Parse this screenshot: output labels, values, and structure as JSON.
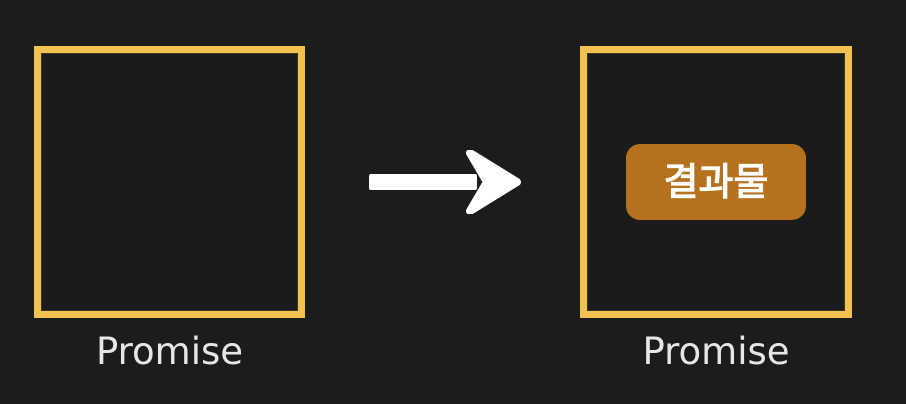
{
  "left_promise": {
    "label": "Promise"
  },
  "arrow": {
    "icon": "right-arrow-icon",
    "color": "#ffffff"
  },
  "right_promise": {
    "label": "Promise",
    "result_badge": "결과물"
  },
  "colors": {
    "background": "#1c1c1c",
    "box_border": "#f2c24e",
    "badge_background": "#b5711e",
    "caption_text": "#e6e6e6"
  }
}
